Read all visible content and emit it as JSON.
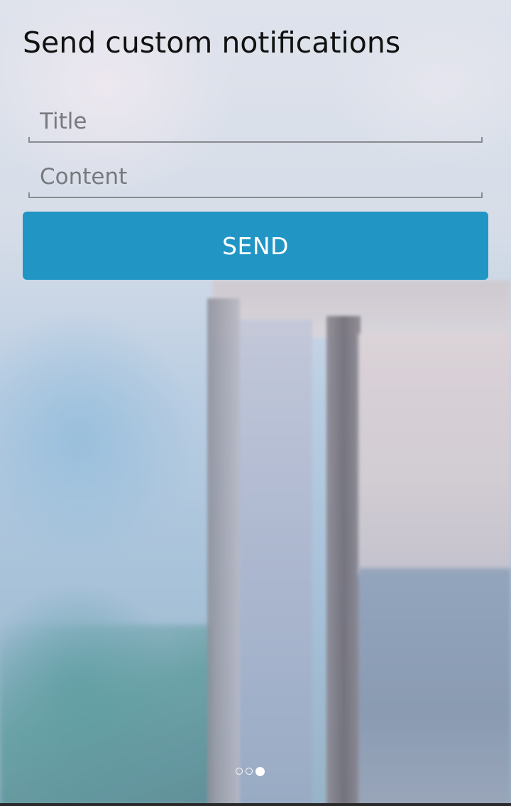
{
  "header": {
    "title": "Send custom notifications"
  },
  "form": {
    "title_field": {
      "placeholder": "Title",
      "value": ""
    },
    "content_field": {
      "placeholder": "Content",
      "value": ""
    },
    "send_label": "SEND"
  },
  "pager": {
    "total_pages": 3,
    "active_page": 3
  },
  "colors": {
    "accent": "#2196c4",
    "title_text": "#111111",
    "placeholder_text": "#77797f",
    "button_text": "#ffffff"
  }
}
